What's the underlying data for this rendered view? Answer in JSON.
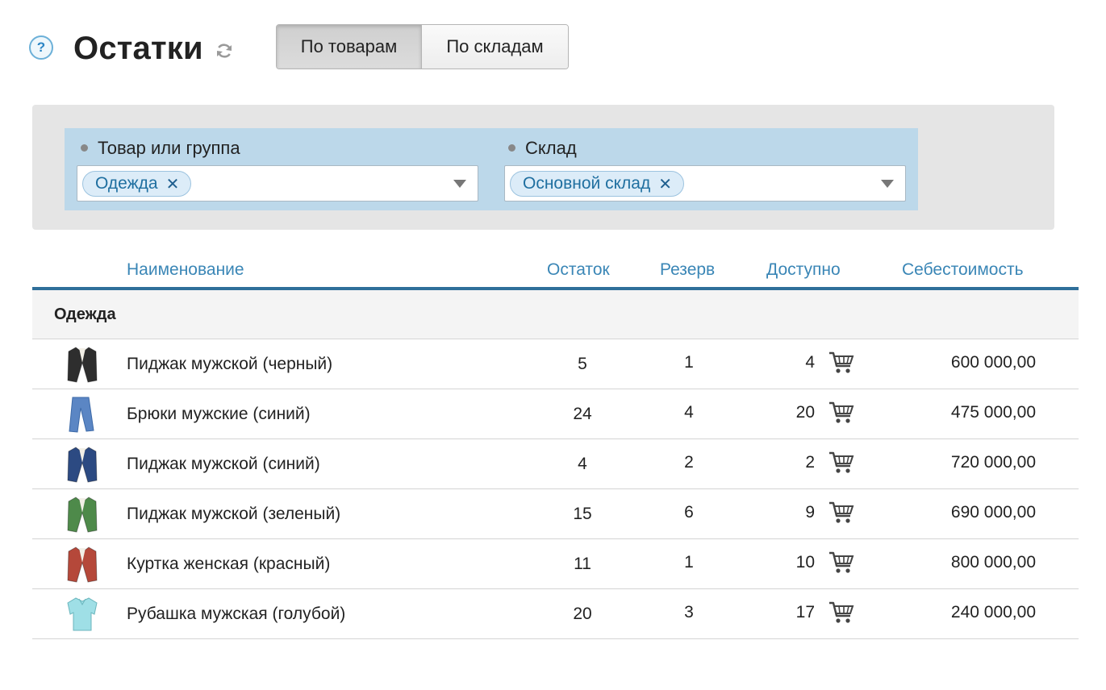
{
  "header": {
    "help_icon": "question-circle-icon",
    "help_symbol": "?",
    "title": "Остатки",
    "refresh_icon": "refresh-icon",
    "view_toggle": [
      {
        "label": "По товарам",
        "active": true
      },
      {
        "label": "По складам",
        "active": false
      }
    ]
  },
  "filters": {
    "product": {
      "label": "Товар или группа",
      "tags": [
        "Одежда"
      ],
      "remove_symbol": "✕"
    },
    "warehouse": {
      "label": "Склад",
      "tags": [
        "Основной склад"
      ],
      "remove_symbol": "✕"
    }
  },
  "table": {
    "columns": {
      "name": "Наименование",
      "stock": "Остаток",
      "reserve": "Резерв",
      "available": "Доступно",
      "cost": "Себестоимость"
    },
    "group": "Одежда",
    "rows": [
      {
        "name": "Пиджак мужской (черный)",
        "stock": "5",
        "reserve": "1",
        "available": "4",
        "cost": "600 000,00",
        "thumb_color": "#2e2e2e"
      },
      {
        "name": "Брюки мужские (синий)",
        "stock": "24",
        "reserve": "4",
        "available": "20",
        "cost": "475 000,00",
        "thumb_color": "#5b86c4"
      },
      {
        "name": "Пиджак мужской (синий)",
        "stock": "4",
        "reserve": "2",
        "available": "2",
        "cost": "720 000,00",
        "thumb_color": "#2c4a82"
      },
      {
        "name": "Пиджак мужской (зеленый)",
        "stock": "15",
        "reserve": "6",
        "available": "9",
        "cost": "690 000,00",
        "thumb_color": "#4e8a4a"
      },
      {
        "name": "Куртка женская (красный)",
        "stock": "11",
        "reserve": "1",
        "available": "10",
        "cost": "800 000,00",
        "thumb_color": "#b5483a"
      },
      {
        "name": "Рубашка мужская (голубой)",
        "stock": "20",
        "reserve": "3",
        "available": "17",
        "cost": "240 000,00",
        "thumb_color": "#9fdfe6"
      }
    ]
  },
  "colors": {
    "accent": "#3a86b6",
    "header_rule": "#2f6f9a",
    "filter_bg": "#bcd8ea",
    "tag_bg": "#dcecf8"
  }
}
